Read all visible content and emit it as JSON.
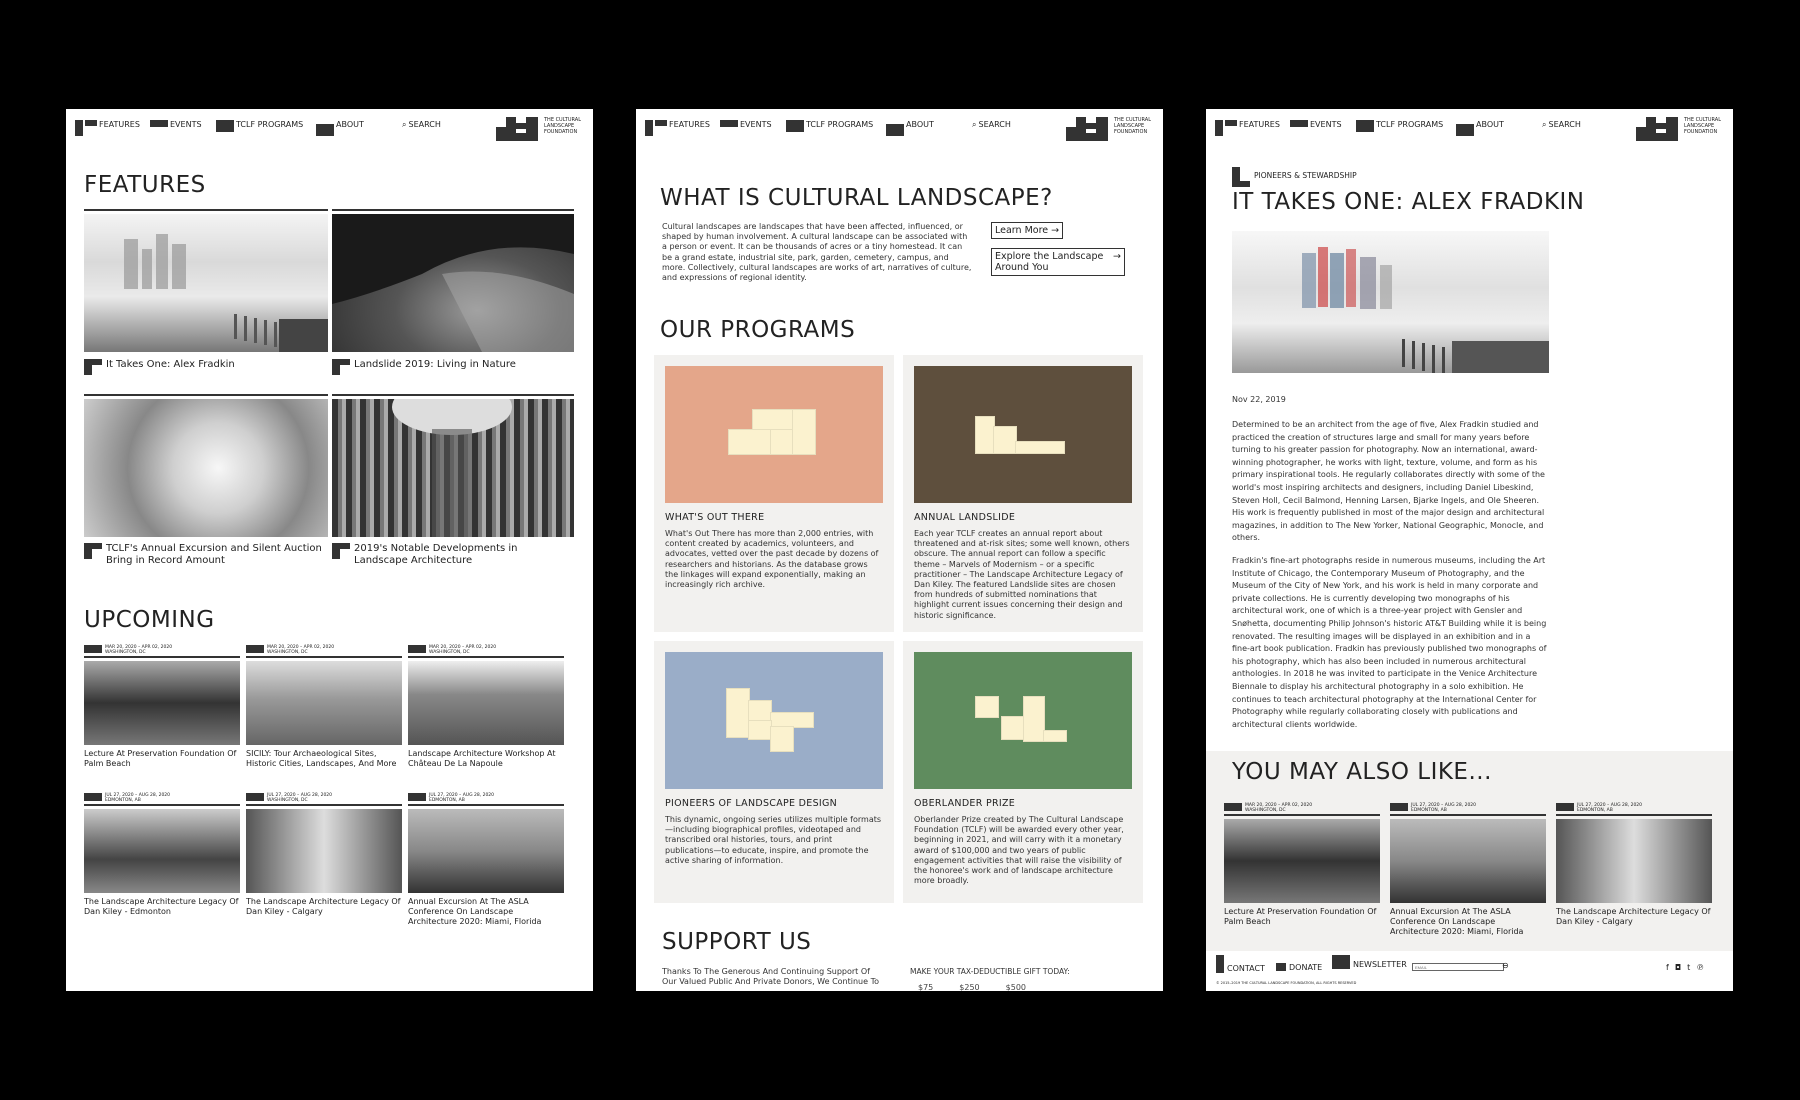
{
  "nav": {
    "features": "FEATURES",
    "events": "EVENTS",
    "programs": "TCLF PROGRAMS",
    "about": "ABOUT",
    "search": "SEARCH",
    "logo_text": "THE CULTURAL LANDSCAPE FOUNDATION"
  },
  "panel1": {
    "features_heading": "FEATURES",
    "features": [
      {
        "title": "It Takes One: Alex Fradkin"
      },
      {
        "title": "Landslide 2019: Living in Nature"
      },
      {
        "title": "TCLF's Annual Excursion and Silent Auction Bring in Record Amount"
      },
      {
        "title": "2019's Notable Developments in Landscape Architecture"
      }
    ],
    "upcoming_heading": "UPCOMING",
    "events": [
      {
        "date": "MAR 20, 2020 – APR 02, 2020",
        "place": "WASHINGTON, DC",
        "title": "Lecture At Preservation Foundation Of Palm Beach"
      },
      {
        "date": "MAR 20, 2020 – APR 02, 2020",
        "place": "WASHINGTON, DC",
        "title": "SICILY: Tour Archaeological Sites, Historic Cities, Landscapes, And More"
      },
      {
        "date": "MAR 20, 2020 – APR 02, 2020",
        "place": "WASHINGTON, DC",
        "title": "Landscape Architecture Workshop At Château De La Napoule"
      },
      {
        "date": "JUL 27, 2020 – AUG 28, 2020",
        "place": "EDMONTON, AB",
        "title": "The Landscape Architecture Legacy Of Dan Kiley - Edmonton"
      },
      {
        "date": "JUL 27, 2020 – AUG 28, 2020",
        "place": "WASHINGTON, DC",
        "title": "The Landscape Architecture Legacy Of Dan Kiley - Calgary"
      },
      {
        "date": "JUL 27, 2020 – AUG 28, 2020",
        "place": "EDMONTON, AB",
        "title": "Annual Excursion At The ASLA Conference On Landscape Architecture 2020: Miami, Florida"
      }
    ]
  },
  "panel2": {
    "what_heading": "WHAT IS CULTURAL LANDSCAPE?",
    "what_text": "Cultural landscapes are landscapes that have been affected, influenced, or shaped by human involvement. A cultural landscape can be associated with a person or event. It can be thousands of acres or a tiny homestead. It can be a grand estate, industrial site, park, garden, cemetery, campus, and more. Collectively, cultural landscapes are works of art, narratives of culture, and expressions of regional identity.",
    "learn_more": "Learn More →",
    "explore": "Explore the Landscape Around You",
    "explore_arrow": "→",
    "programs_heading": "OUR PROGRAMS",
    "programs": [
      {
        "title": "WHAT'S OUT THERE",
        "color": "#e4a68a",
        "text": "What's Out There has more than 2,000 entries, with content created by academics, volunteers, and advocates, vetted over the past decade by dozens of researchers and historians. As the database grows the linkages will expand exponentially, making an increasingly rich archive."
      },
      {
        "title": "ANNUAL LANDSLIDE",
        "color": "#5e4f3d",
        "text": "Each year TCLF creates an annual report about threatened and at-risk sites; some well known, others obscure. The annual report can follow a specific theme – Marvels of Modernism – or a specific practitioner – The Landscape Architecture Legacy of Dan Kiley. The featured Landslide sites are chosen from hundreds of submitted nominations that highlight current issues concerning their design and historic significance."
      },
      {
        "title": "PIONEERS OF LANDSCAPE DESIGN",
        "color": "#9aadc8",
        "text": "This dynamic, ongoing series utilizes multiple formats—including biographical profiles, videotaped and transcribed oral histories, tours, and print publications—to educate, inspire, and promote the active sharing of information."
      },
      {
        "title": "OBERLANDER PRIZE",
        "color": "#5f8c5e",
        "text": "Oberlander Prize created by The Cultural Landscape Foundation (TCLF) will be awarded every other year, beginning in 2021, and will carry with it a monetary award of $100,000 and two years of public engagement activities that will raise the visibility of the honoree's work and of landscape architecture more broadly."
      }
    ],
    "support_heading": "SUPPORT US",
    "support_text": "Thanks To The Generous And Continuing Support Of Our Valued Public And Private Donors, We Continue To",
    "gift_label": "MAKE YOUR TAX-DEDUCTIBLE GIFT TODAY:",
    "amounts": [
      "$75",
      "$250",
      "$500"
    ]
  },
  "panel3": {
    "category": "PIONEERS & STEWARDSHIP",
    "title": "IT TAKES ONE: ALEX FRADKIN",
    "date": "Nov 22, 2019",
    "para1": "Determined to be an architect from the age of five, Alex Fradkin studied and practiced the creation of structures large and small for many years before turning to his greater passion for photography. Now an international, award-winning photographer, he works with light, texture, volume, and form as his primary inspirational tools. He regularly collaborates directly with some of the world's most inspiring architects and designers, including Daniel Libeskind, Steven Holl, Cecil Balmond, Henning Larsen, Bjarke Ingels, and Ole Sheeren. His work is frequently published in most of the major design and architectural magazines, in addition to The New Yorker, National Geographic, Monocle, and others.",
    "para2": "Fradkin's fine-art photographs reside in numerous museums, including the Art Institute of Chicago, the Contemporary Museum of Photography, and the Museum of the City of New York, and his work is held in many corporate and private collections. He is currently developing two monographs of his architectural work, one of which is a three-year project with Gensler and Snøhetta, documenting Philip Johnson's historic AT&T Building while it is being renovated. The resulting images will be displayed in an exhibition and in a fine-art book publication. Fradkin has previously published two monographs of his photography, which has also been included in numerous architectural anthologies. In 2018 he was invited to participate in the Venice Architecture Biennale to display his architectural photography in a solo exhibition. He continues to teach architectural photography at the International Center for Photography while regularly collaborating closely with publications and architectural clients worldwide.",
    "also_heading": "YOU MAY ALSO LIKE...",
    "also": [
      {
        "date": "MAR 20, 2020 – APR 02, 2020",
        "place": "WASHINGTON, DC",
        "title": "Lecture At Preservation Foundation Of Palm Beach"
      },
      {
        "date": "JUL 27, 2020 – AUG 28, 2020",
        "place": "EDMONTON, AB",
        "title": "Annual Excursion At The ASLA Conference On Landscape Architecture 2020: Miami, Florida"
      },
      {
        "date": "JUL 27, 2020 – AUG 28, 2020",
        "place": "EDMONTON, AB",
        "title": "The Landscape Architecture Legacy Of Dan Kiley - Calgary"
      }
    ],
    "footer": {
      "contact": "CONTACT",
      "donate": "DONATE",
      "newsletter": "NEWSLETTER",
      "email_placeholder": "EMAIL",
      "copyright": "© 2015–2019 THE CULTURAL LANDSCAPE FOUNDATION, ALL RIGHTS RESERVED",
      "social": [
        "f",
        "◘",
        "t",
        "℗"
      ]
    }
  }
}
